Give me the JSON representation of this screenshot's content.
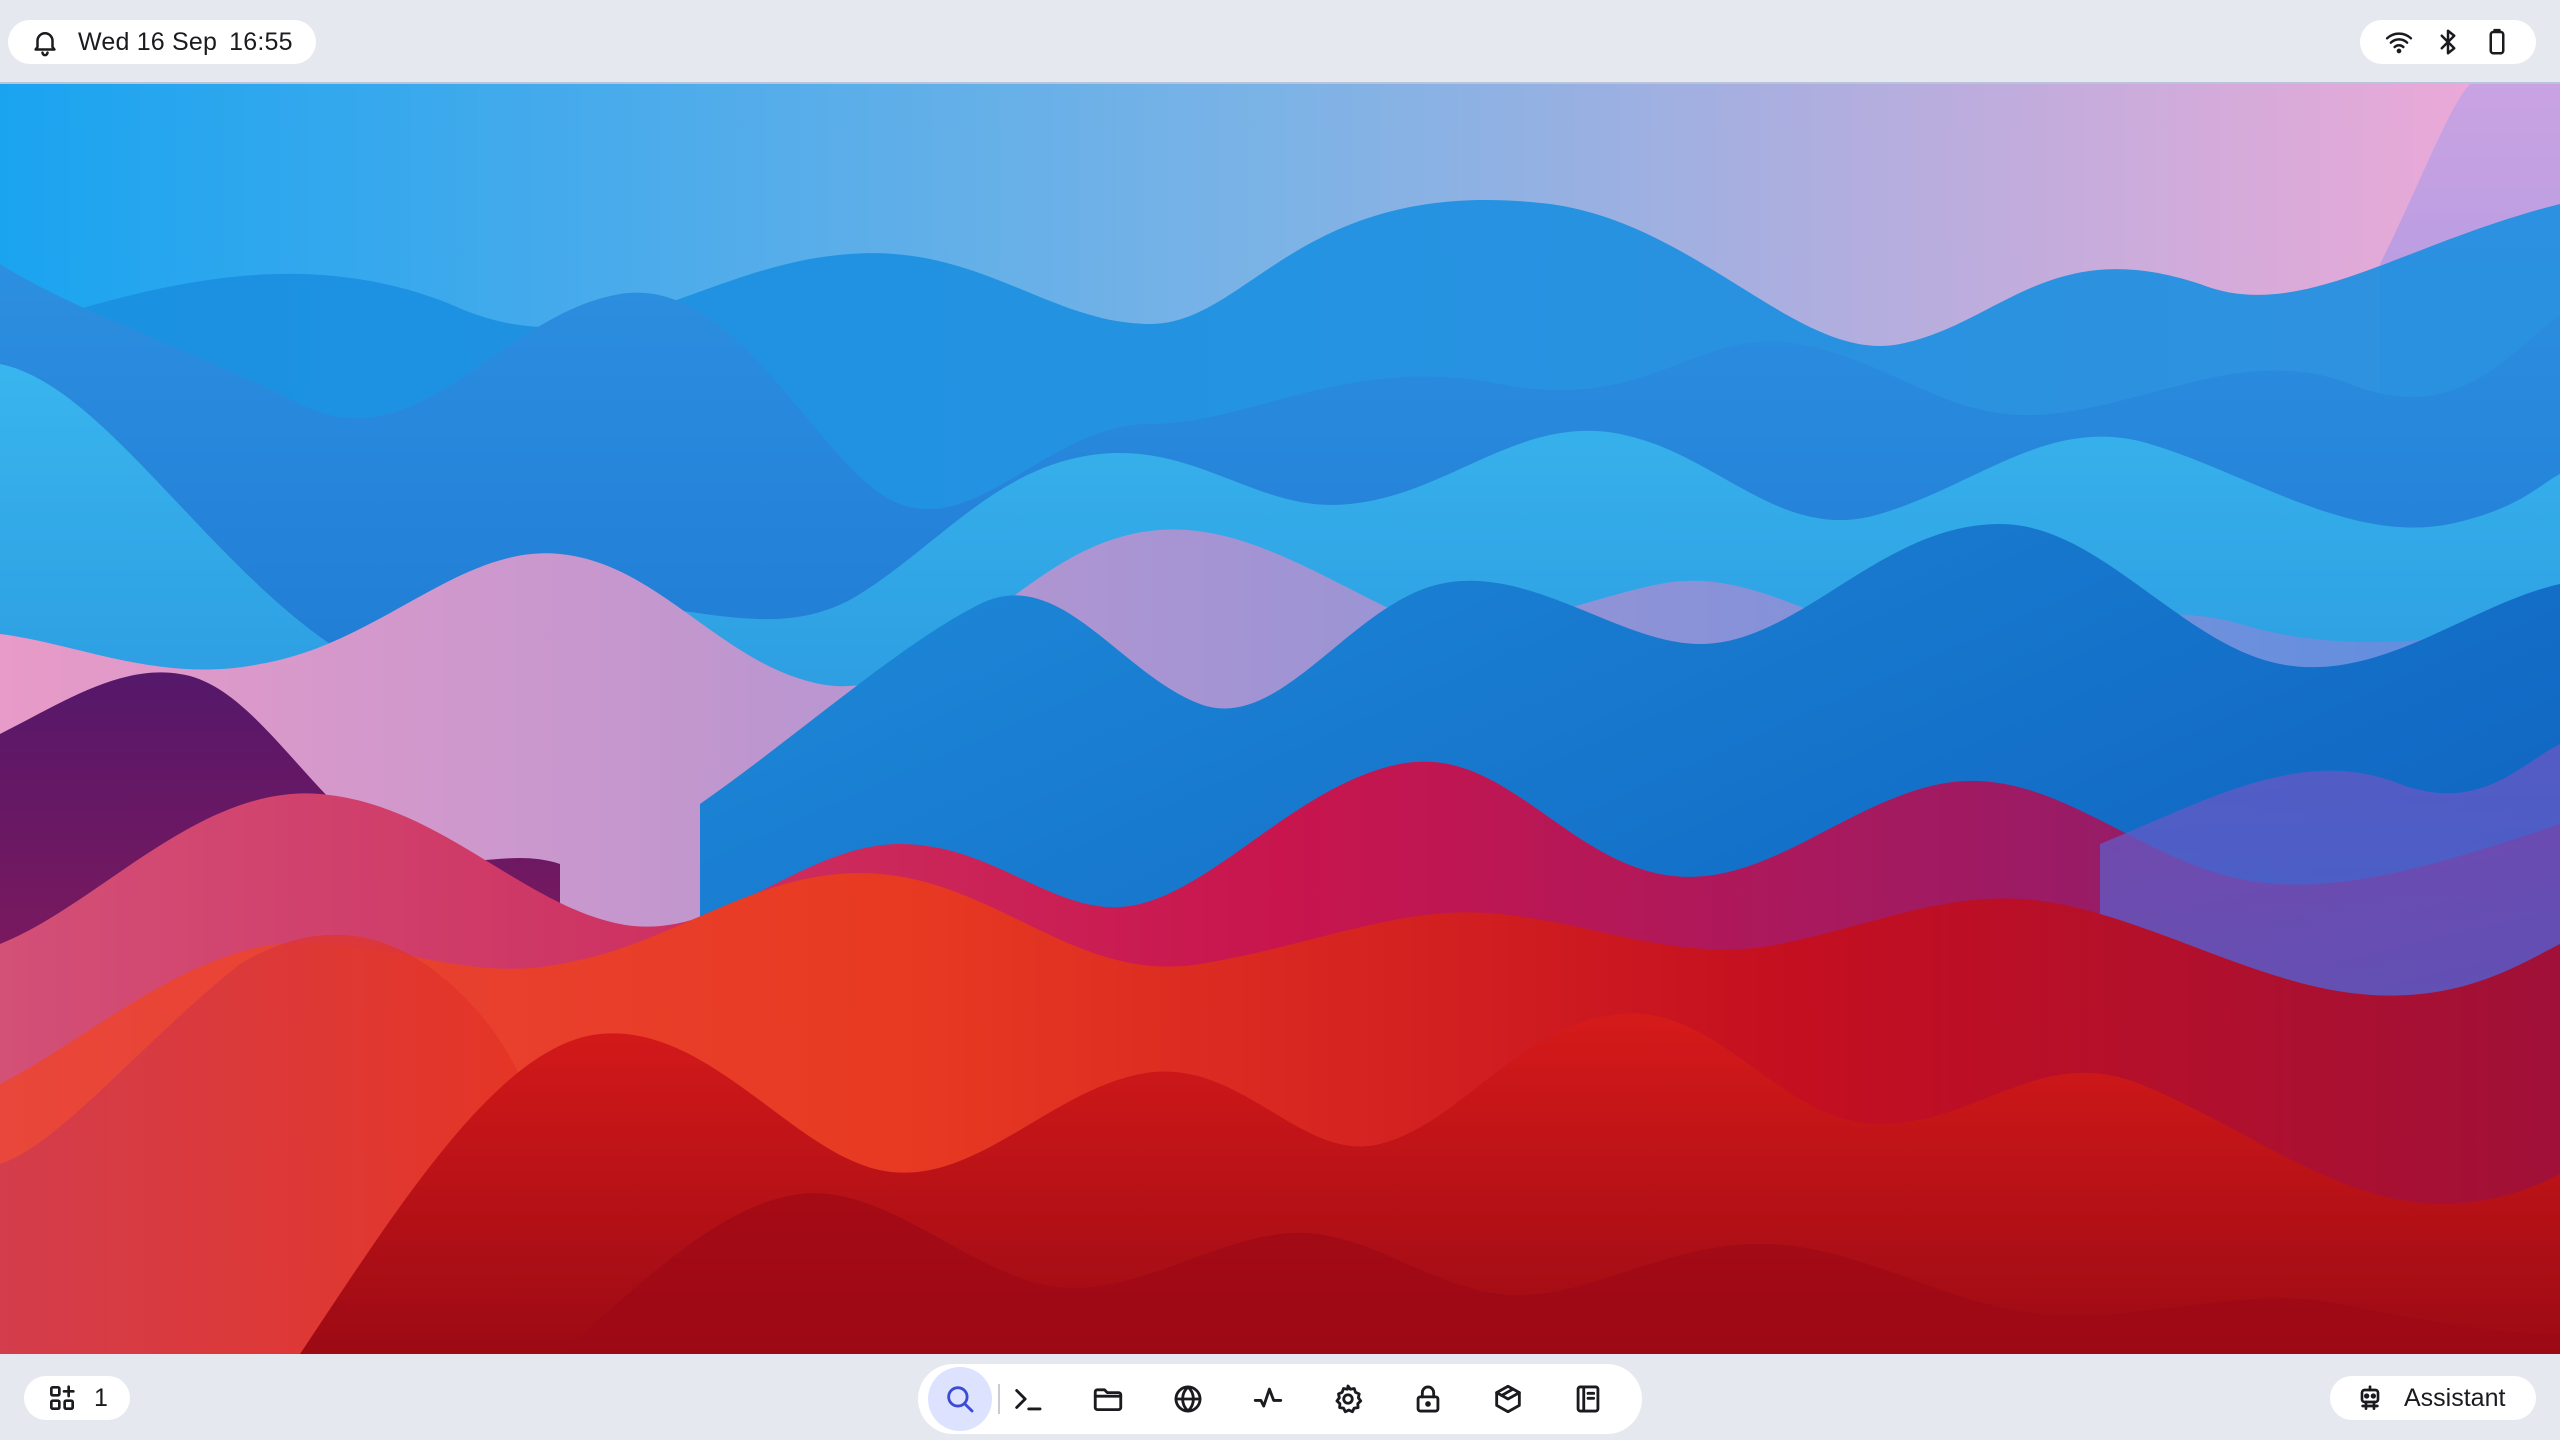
{
  "top_bar": {
    "notification_icon": "bell-icon",
    "date": "Wed 16 Sep",
    "time": "16:55",
    "status_icons": [
      "wifi-icon",
      "bluetooth-icon",
      "battery-icon"
    ]
  },
  "bottom_bar": {
    "workspace": {
      "icon": "workspaces-icon",
      "number": "1"
    },
    "dock": {
      "items": [
        {
          "name": "search",
          "icon": "search-icon",
          "active": true
        },
        {
          "name": "terminal",
          "icon": "terminal-icon",
          "active": false
        },
        {
          "name": "files",
          "icon": "folder-icon",
          "active": false
        },
        {
          "name": "browser",
          "icon": "globe-icon",
          "active": false
        },
        {
          "name": "system-monitor",
          "icon": "activity-icon",
          "active": false
        },
        {
          "name": "settings",
          "icon": "gear-icon",
          "active": false
        },
        {
          "name": "lock",
          "icon": "lock-icon",
          "active": false
        },
        {
          "name": "app-store",
          "icon": "package-icon",
          "active": false
        },
        {
          "name": "notes",
          "icon": "notebook-icon",
          "active": false
        }
      ]
    },
    "assistant": {
      "icon": "robot-icon",
      "label": "Assistant"
    }
  },
  "colors": {
    "bar_background": "#e6e8ef",
    "pill_background": "#ffffff",
    "active_dock_item": "#dde3ff",
    "accent": "#3b4bd8"
  }
}
